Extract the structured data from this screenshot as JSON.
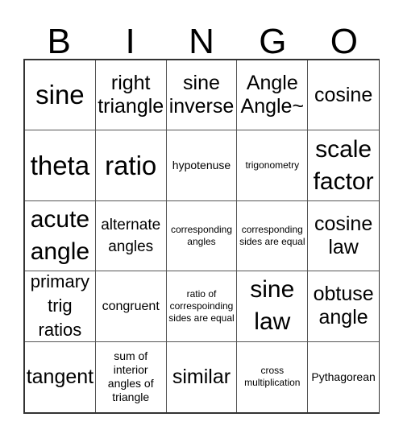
{
  "header": {
    "letters": [
      "B",
      "I",
      "N",
      "G",
      "O"
    ]
  },
  "grid": {
    "cells": [
      "sine",
      "right triangle",
      "sine inverse",
      "Angle Angle~",
      "cosine",
      "theta",
      "ratio",
      "hypotenuse",
      "trigonometry",
      "scale factor",
      "acute angle",
      "alternate angles",
      "corresponding angles",
      "corresponding sides are equal",
      "cosine law",
      "primary trig ratios",
      "congruent",
      "ratio of correspoinding sides are equal",
      "sine law",
      "obtuse angle",
      "tangent",
      "sum of interior angles of triangle",
      "similar",
      "cross multiplication",
      "Pythagorean"
    ]
  }
}
